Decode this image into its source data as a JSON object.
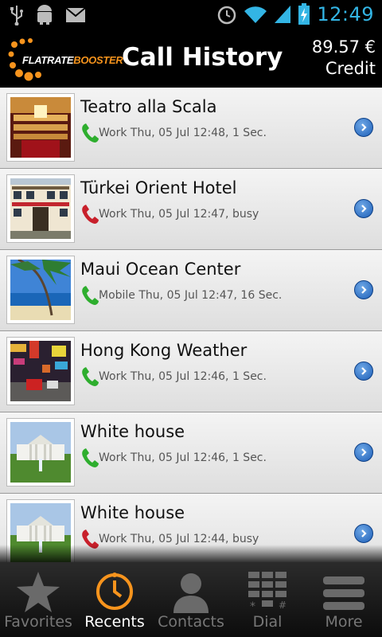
{
  "status_bar": {
    "time": "12:49",
    "icons": [
      "usb-icon",
      "android-debug-icon",
      "mail-icon",
      "alarm-icon",
      "wifi-icon",
      "signal-icon",
      "battery-charging-icon"
    ]
  },
  "header": {
    "logo": {
      "part1": "FLATRATE",
      "part2": "BOOSTER"
    },
    "title": "Call History",
    "credit_amount": "89.57 €",
    "credit_label": "Credit"
  },
  "colors": {
    "accent_orange": "#f7941d",
    "time_blue": "#33b5e5",
    "call_ok_green": "#2eae2e",
    "call_busy_red": "#c8202b"
  },
  "calls": [
    {
      "name": "Teatro alla Scala",
      "detail": "Work Thu, 05 Jul 12:48, 1 Sec.",
      "status": "ok",
      "image": "opera-house"
    },
    {
      "name": "Türkei Orient Hotel",
      "detail": "Work Thu, 05 Jul 12:47, busy",
      "status": "busy",
      "image": "hotel"
    },
    {
      "name": "Maui Ocean Center",
      "detail": "Mobile Thu, 05 Jul 12:47, 16 Sec.",
      "status": "ok",
      "image": "beach"
    },
    {
      "name": "Hong Kong Weather",
      "detail": "Work Thu, 05 Jul 12:46, 1 Sec.",
      "status": "ok",
      "image": "city-street"
    },
    {
      "name": "White house",
      "detail": "Work Thu, 05 Jul 12:46, 1 Sec.",
      "status": "ok",
      "image": "white-house"
    },
    {
      "name": "White house",
      "detail": "Work Thu, 05 Jul 12:44, busy",
      "status": "busy",
      "image": "white-house"
    }
  ],
  "tabs": [
    {
      "label": "Favorites",
      "icon": "star-icon",
      "active": false
    },
    {
      "label": "Recents",
      "icon": "clock-icon",
      "active": true
    },
    {
      "label": "Contacts",
      "icon": "person-icon",
      "active": false
    },
    {
      "label": "Dial",
      "icon": "dialpad-icon",
      "active": false
    },
    {
      "label": "More",
      "icon": "menu-icon",
      "active": false
    }
  ]
}
